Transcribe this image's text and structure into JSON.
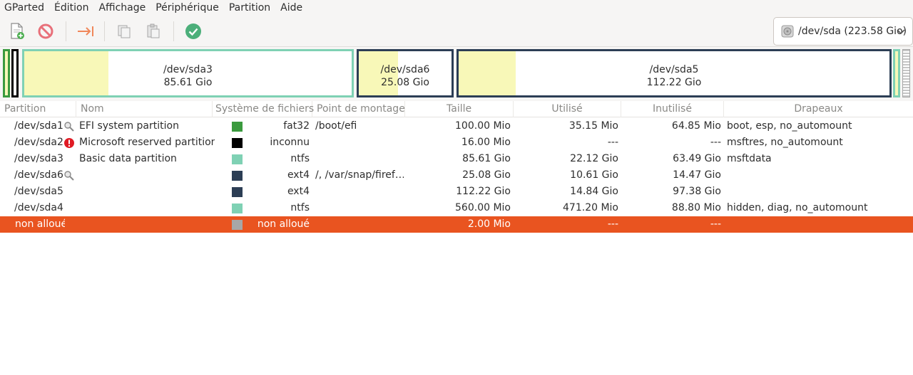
{
  "menu": [
    "GParted",
    "Édition",
    "Affichage",
    "Périphérique",
    "Partition",
    "Aide"
  ],
  "toolbar": {
    "buttons": [
      {
        "name": "new-partition-button",
        "icon": "new-document-icon"
      },
      {
        "name": "delete-partition-button",
        "icon": "forbidden-icon"
      },
      {
        "name": "resize-move-button",
        "icon": "arrow-right-to-bar-icon"
      },
      {
        "name": "copy-button",
        "icon": "copy-icon"
      },
      {
        "name": "paste-button",
        "icon": "paste-icon"
      },
      {
        "name": "apply-button",
        "icon": "checkmark-circle-icon"
      }
    ],
    "device": "/dev/sda (223.58 Gio)"
  },
  "partition_map": [
    {
      "name": "/dev/sda3",
      "size": "85.61 Gio",
      "border_color": "#7fd1b4",
      "used_fraction": 0.258
    },
    {
      "name": "/dev/sda6",
      "size": "25.08 Gio",
      "border_color": "#2c3e55",
      "used_fraction": 0.423
    },
    {
      "name": "/dev/sda5",
      "size": "112.22 Gio",
      "border_color": "#2c3e55",
      "used_fraction": 0.132
    }
  ],
  "table": {
    "headers": [
      "Partition",
      "Nom",
      "Système de fichiers",
      "Point de montage",
      "Taille",
      "Utilisé",
      "Inutilisé",
      "Drapeaux"
    ],
    "rows": [
      {
        "partition": "/dev/sda1",
        "icon": "magnifier-key-icon",
        "nom": "EFI system partition",
        "color": "#3a9a3e",
        "fs": "fat32",
        "mount": "/boot/efi",
        "size": "100.00 Mio",
        "used": "35.15 Mio",
        "unused": "64.85 Mio",
        "flags": "boot, esp, no_automount"
      },
      {
        "partition": "/dev/sda2",
        "icon": "error-icon",
        "nom": "Microsoft reserved partition",
        "color": "#000000",
        "fs": "inconnu",
        "mount": "",
        "size": "16.00 Mio",
        "used": "---",
        "unused": "---",
        "flags": "msftres, no_automount"
      },
      {
        "partition": "/dev/sda3",
        "icon": "",
        "nom": "Basic data partition",
        "color": "#7fd1b4",
        "fs": "ntfs",
        "mount": "",
        "size": "85.61 Gio",
        "used": "22.12 Gio",
        "unused": "63.49 Gio",
        "flags": "msftdata"
      },
      {
        "partition": "/dev/sda6",
        "icon": "magnifier-key-icon",
        "nom": "",
        "color": "#2c3e55",
        "fs": "ext4",
        "mount": "/, /var/snap/firef…",
        "size": "25.08 Gio",
        "used": "10.61 Gio",
        "unused": "14.47 Gio",
        "flags": ""
      },
      {
        "partition": "/dev/sda5",
        "icon": "",
        "nom": "",
        "color": "#2c3e55",
        "fs": "ext4",
        "mount": "",
        "size": "112.22 Gio",
        "used": "14.84 Gio",
        "unused": "97.38 Gio",
        "flags": ""
      },
      {
        "partition": "/dev/sda4",
        "icon": "",
        "nom": "",
        "color": "#7fd1b4",
        "fs": "ntfs",
        "mount": "",
        "size": "560.00 Mio",
        "used": "471.20 Mio",
        "unused": "88.80 Mio",
        "flags": "hidden, diag, no_automount"
      },
      {
        "partition": "non alloué",
        "icon": "",
        "nom": "",
        "color": "#a7a7a7",
        "fs": "non alloué",
        "mount": "",
        "size": "2.00 Mio",
        "used": "---",
        "unused": "---",
        "flags": "",
        "selected": true
      }
    ]
  },
  "colors": {
    "accent": "#e95420",
    "used_space": "#f8f8b8"
  }
}
